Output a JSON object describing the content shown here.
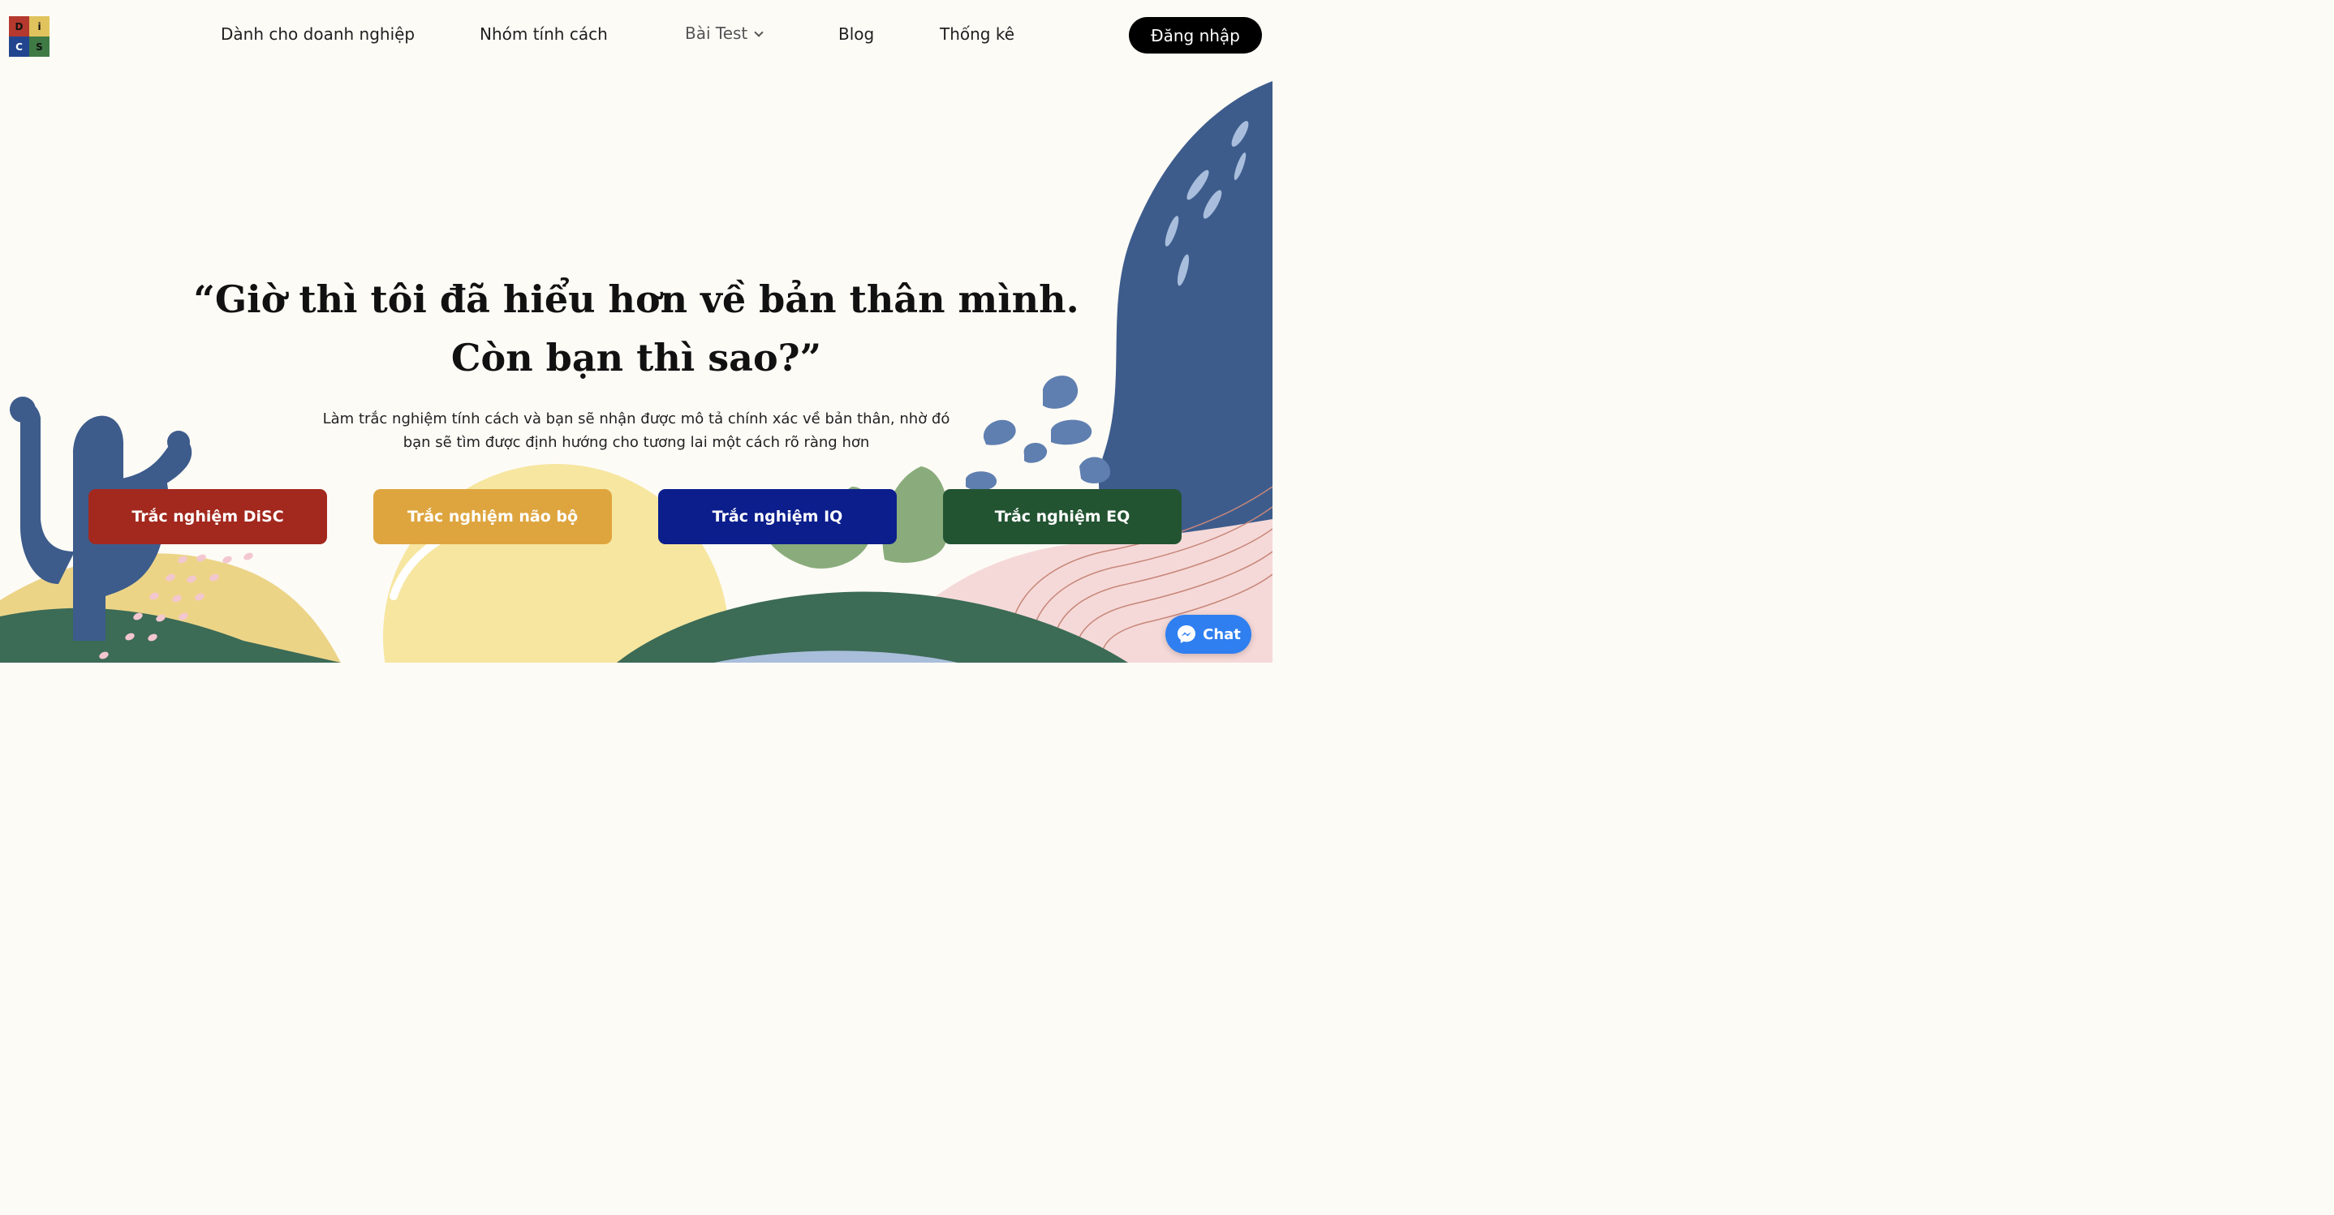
{
  "nav": {
    "logo_letters": [
      "D",
      "i",
      "C",
      "S"
    ],
    "links": [
      "Dành cho doanh nghiệp",
      "Nhóm tính cách",
      "Bài Test",
      "Blog",
      "Thống kê"
    ],
    "login_label": "Đăng nhập"
  },
  "hero": {
    "headline_line1": "“Giờ thì tôi đã hiểu hơn về bản thân mình.",
    "headline_line2": "Còn bạn thì sao?”",
    "subtitle_line1": "Làm trắc nghiệm tính cách và bạn sẽ nhận được mô tả chính xác về bản thân, nhờ đó",
    "subtitle_line2": "bạn sẽ tìm được định hướng cho tương lai một cách rõ ràng hơn"
  },
  "cta": [
    {
      "label": "Trắc nghiệm DiSC",
      "color": "#a3281e"
    },
    {
      "label": "Trắc nghiệm não bộ",
      "color": "#dea53f"
    },
    {
      "label": "Trắc nghiệm IQ",
      "color": "#0b1e8c"
    },
    {
      "label": "Trắc nghiệm EQ",
      "color": "#235432"
    }
  ],
  "chat": {
    "label": "Chat"
  },
  "colors": {
    "background": "#fdfbf6",
    "blue_blob": "#3d5c8c",
    "sun": "#f6e6a0",
    "sand": "#ecd487",
    "hill": "#3c6b56",
    "pink": "#f5d9d8",
    "leaf": "#8aac7c"
  }
}
